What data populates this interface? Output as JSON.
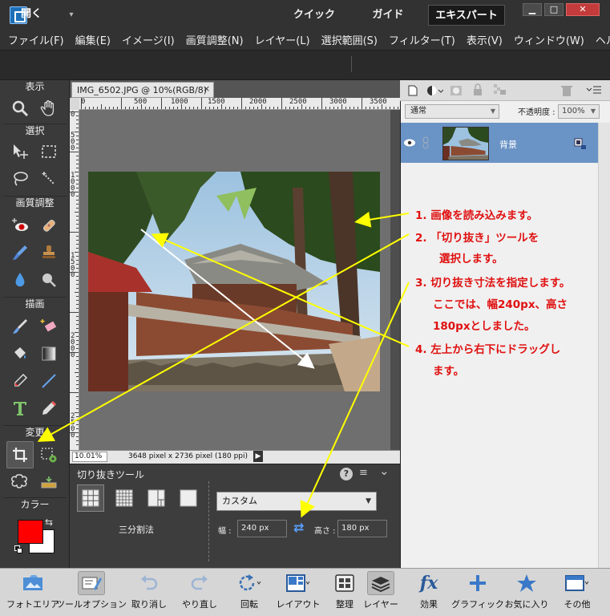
{
  "window": {
    "min_icon": "▁",
    "max_icon": "□",
    "close_icon": "✕"
  },
  "menu": [
    "ファイル(F)",
    "編集(E)",
    "イメージ(I)",
    "画質調整(N)",
    "レイヤー(L)",
    "選択範囲(S)",
    "フィルター(T)",
    "表示(V)",
    "ウィンドウ(W)",
    "ヘルプ("
  ],
  "modebar": {
    "open": "開く",
    "open_caret": "▾",
    "tabs": [
      "クイック",
      "ガイド",
      "エキスパート"
    ]
  },
  "toolbox": {
    "sections": [
      "表示",
      "選択",
      "画質調整",
      "描画",
      "変更",
      "カラー"
    ],
    "swap_icon": "⇆"
  },
  "document": {
    "tab_title": "IMG_6502.JPG @ 10%(RGB/8)",
    "tab_close": "×",
    "ruler_top": [
      "0",
      "500",
      "1000",
      "1500",
      "2000",
      "2500",
      "3000",
      "3500"
    ],
    "ruler_left": [
      "0",
      "5 0 0",
      "1 0 0 0",
      "1 5 0 0",
      "2 0 0 0",
      "2 5 0 0"
    ],
    "zoom": "10.01%",
    "info": "3648 pixel x 2736 pixel (180 ppi)",
    "status_arrow": "▶"
  },
  "tool_options": {
    "title": "切り抜きツール",
    "overlay_label": "三分割法",
    "preset": "カスタム",
    "preset_caret": "▼",
    "width_label": "幅 :",
    "width_value": "240 px",
    "height_label": "高さ :",
    "height_value": "180 px",
    "swap_icon": "⇄",
    "help_icon": "?",
    "menu_icon": "≡",
    "collapse_icon": "⌄"
  },
  "layers_panel": {
    "blend_mode": "通常",
    "blend_caret": "▼",
    "opacity_label": "不透明度 :",
    "opacity_value": "100%",
    "layer_name": "背景"
  },
  "dock": [
    {
      "label": "フォトエリア",
      "icon": "photo-bin-icon"
    },
    {
      "label": "ツールオプション",
      "icon": "tool-options-icon"
    },
    {
      "label": "取り消し",
      "icon": "undo-icon"
    },
    {
      "label": "やり直し",
      "icon": "redo-icon"
    },
    {
      "label": "回転",
      "icon": "rotate-icon"
    },
    {
      "label": "レイアウト",
      "icon": "layout-icon"
    },
    {
      "label": "整理",
      "icon": "organizer-icon"
    },
    {
      "label": "レイヤー",
      "icon": "layers-icon"
    },
    {
      "label": "効果",
      "icon": "effects-icon"
    },
    {
      "label": "グラフィック",
      "icon": "graphics-icon"
    },
    {
      "label": "お気に入り",
      "icon": "favorites-icon"
    },
    {
      "label": "その他",
      "icon": "more-icon"
    }
  ],
  "annotations": [
    "1. 画像を読み込みます。",
    "2. 「切り抜き」ツールを",
    "選択します。",
    "3. 切り抜き寸法を指定します。",
    "ここでは、幅240px、高さ",
    "180pxとしました。",
    "4. 左上から右下にドラッグし",
    "ます。"
  ],
  "colors": {
    "foreground": "#ff0000",
    "background": "#ffffff",
    "annotation": "#e01010",
    "arrow": "#ffff00",
    "layer_selected": "#6a93c6"
  }
}
